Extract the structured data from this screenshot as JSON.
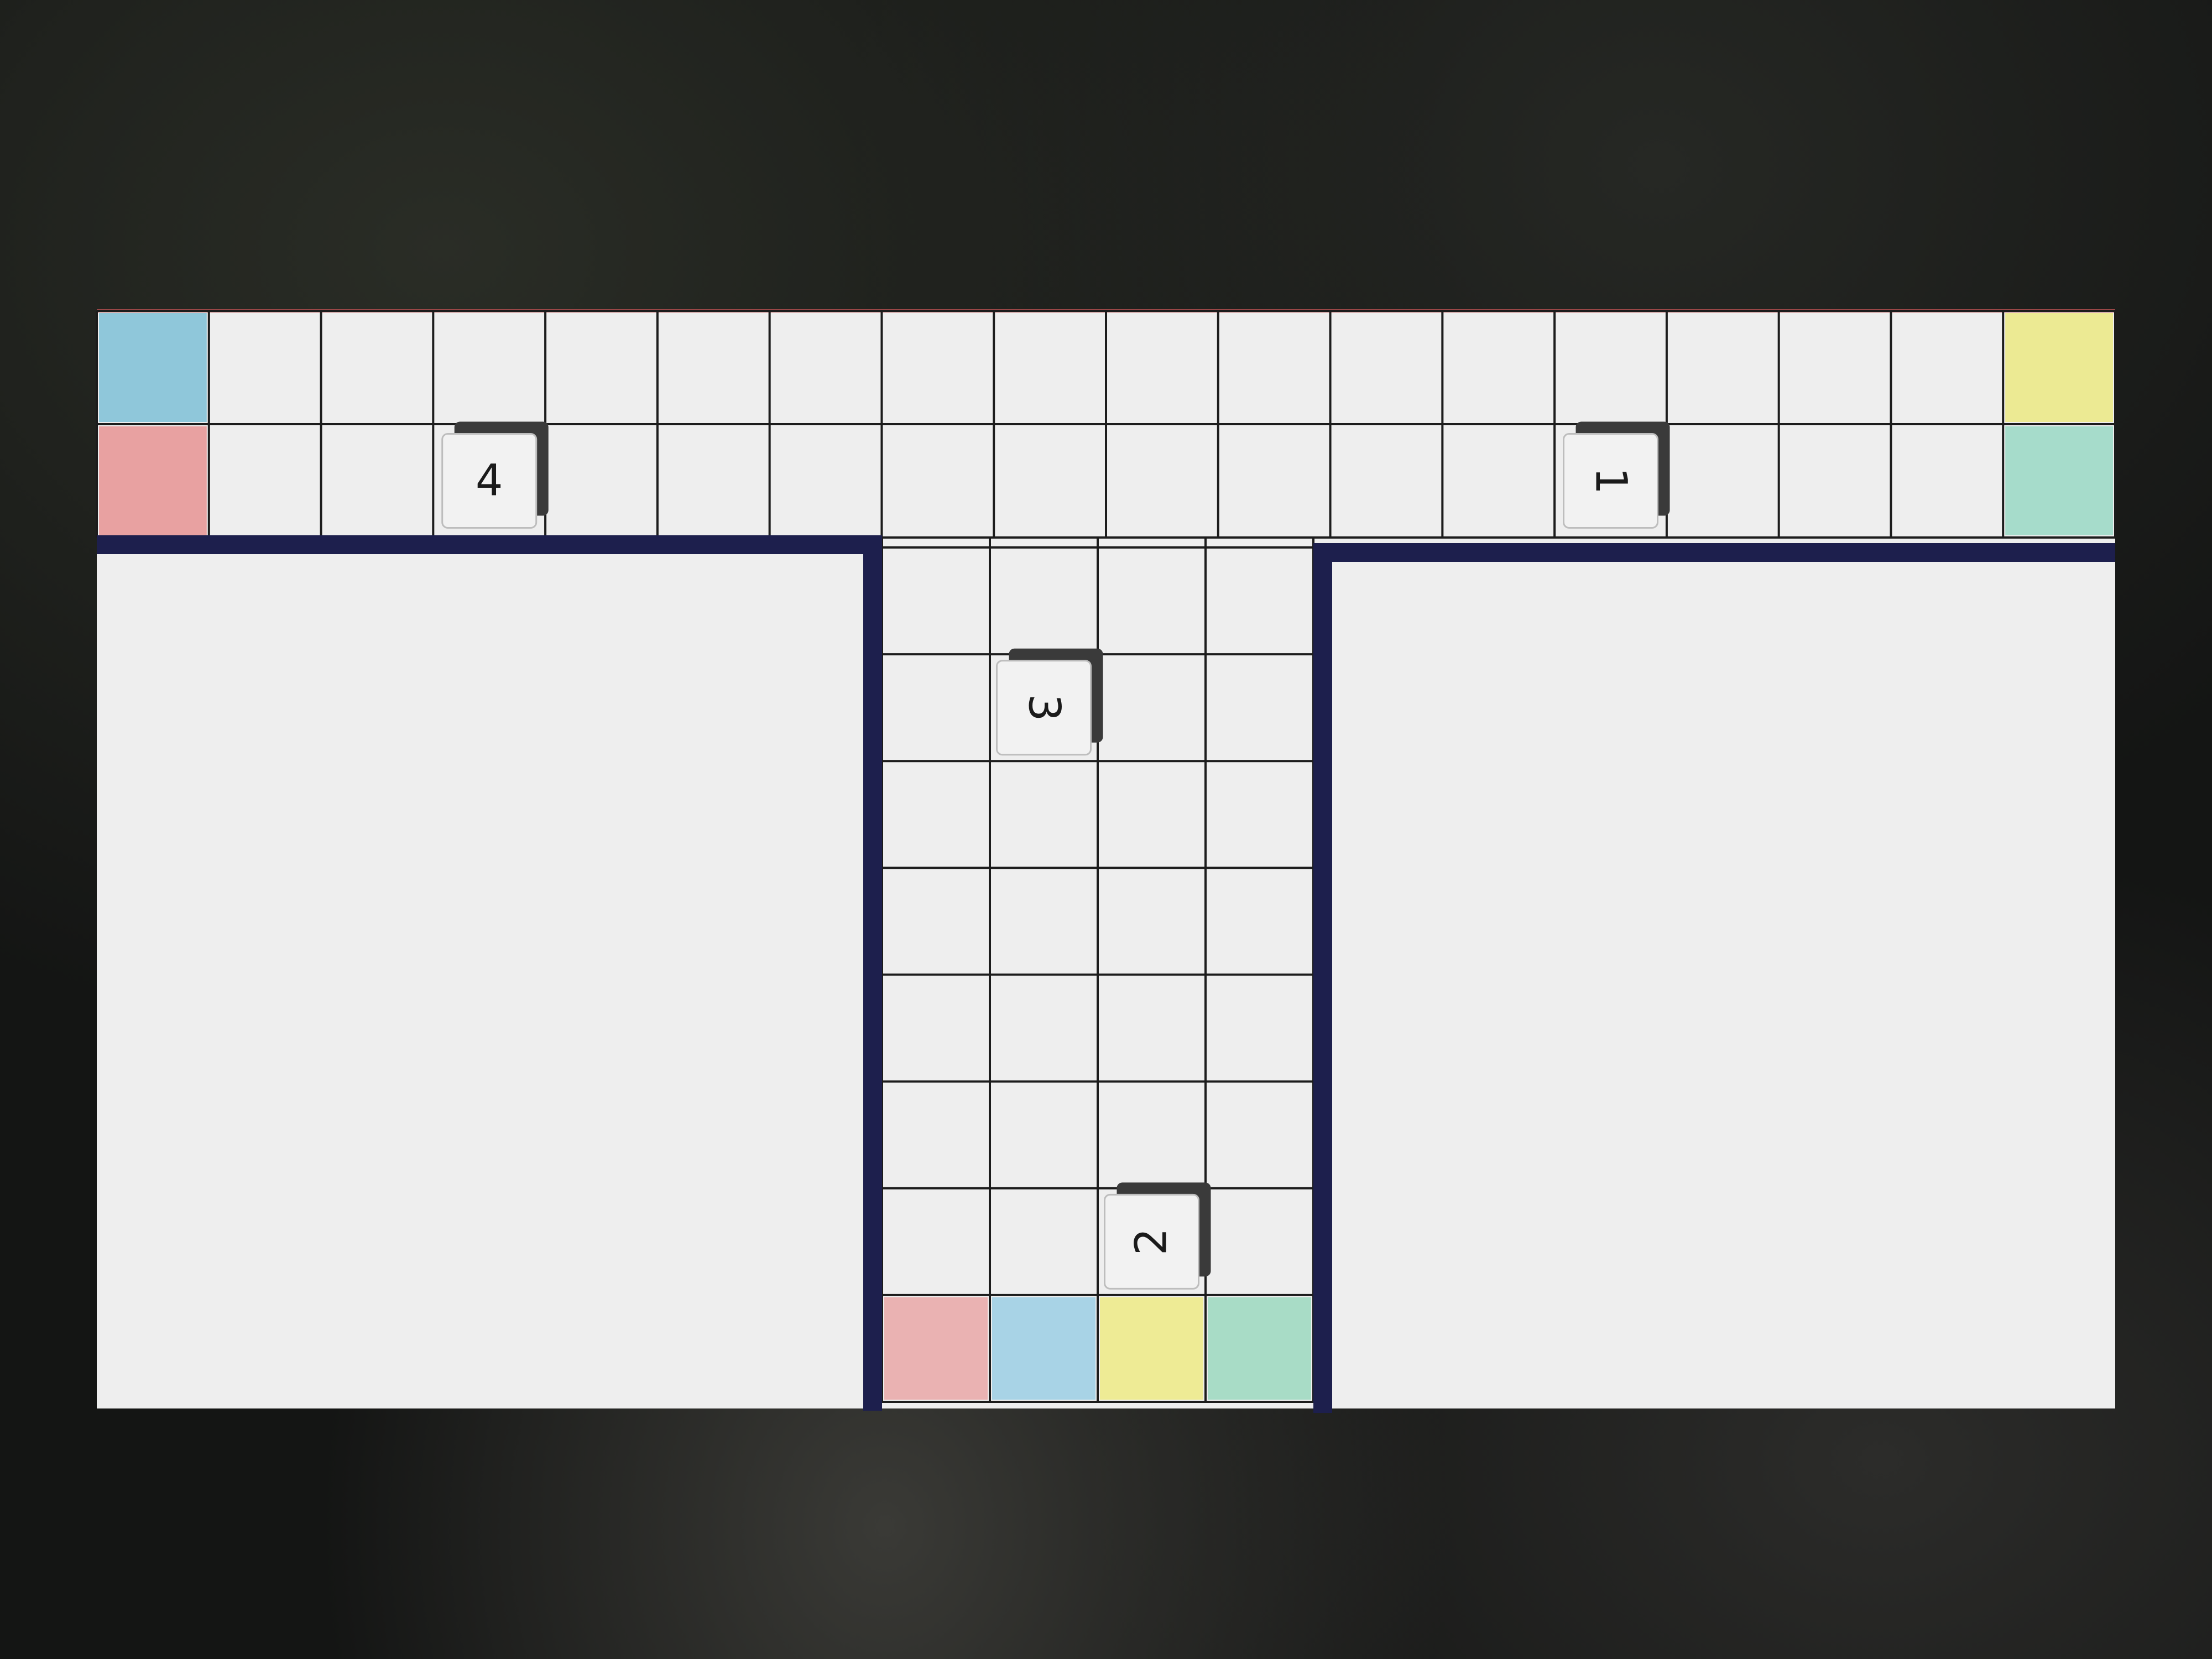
{
  "game": {
    "colors": {
      "background": "#141514",
      "paper": "#eeeeee",
      "grid_line": "#1c1c1c",
      "wall": "#1d1f4d",
      "red_edge": "#b55050",
      "die_face": "#f2f2f2",
      "die_shadow": "#3a3a3a"
    },
    "top_corridor": {
      "rows": 2,
      "cols": 18
    },
    "vertical_corridor": {
      "rows": 8,
      "cols": 4
    },
    "colored_cells": [
      {
        "id": "top-left-blue",
        "area": "top",
        "row": 0,
        "col": 0,
        "color": "#8fc7da"
      },
      {
        "id": "top-left-red",
        "area": "top",
        "row": 1,
        "col": 0,
        "color": "#e8a1a1"
      },
      {
        "id": "top-right-yellow",
        "area": "top",
        "row": 0,
        "col": 17,
        "color": "#ecea93"
      },
      {
        "id": "top-right-teal",
        "area": "top",
        "row": 1,
        "col": 17,
        "color": "#a6dccb"
      },
      {
        "id": "bottom-red",
        "area": "vertical",
        "row": 7,
        "col": 0,
        "color": "#eab2b2"
      },
      {
        "id": "bottom-blue",
        "area": "vertical",
        "row": 7,
        "col": 1,
        "color": "#a8d3e6"
      },
      {
        "id": "bottom-yellow",
        "area": "vertical",
        "row": 7,
        "col": 2,
        "color": "#eeeb95"
      },
      {
        "id": "bottom-teal",
        "area": "vertical",
        "row": 7,
        "col": 3,
        "color": "#a8dcc6"
      }
    ],
    "dice": [
      {
        "id": "4",
        "label": "4",
        "area": "top",
        "row": 1,
        "col": 3,
        "rotation": 0
      },
      {
        "id": "1",
        "label": "1",
        "area": "top",
        "row": 1,
        "col": 13,
        "rotation": 90
      },
      {
        "id": "3",
        "label": "3",
        "area": "vertical",
        "row": 1,
        "col": 1,
        "rotation": 90
      },
      {
        "id": "2",
        "label": "2",
        "area": "vertical",
        "row": 6,
        "col": 2,
        "rotation": -90
      }
    ]
  }
}
